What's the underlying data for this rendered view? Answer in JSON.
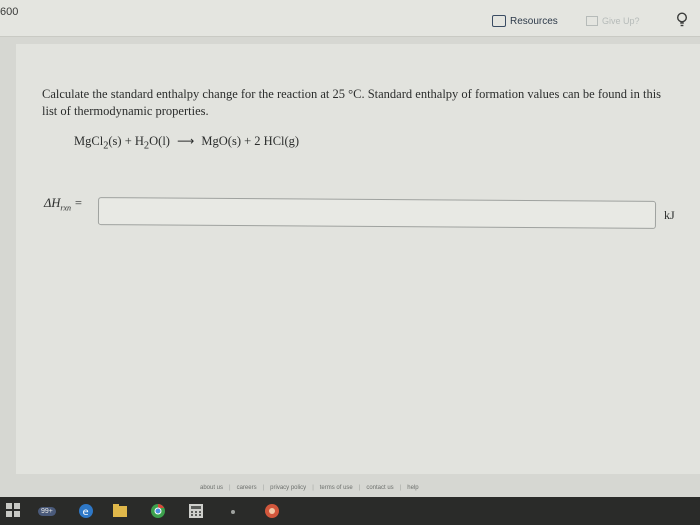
{
  "topbar": {
    "score": "600",
    "resources_label": "Resources",
    "give_up_label": "Give Up?"
  },
  "question": {
    "prompt": "Calculate the standard enthalpy change for the reaction at 25 °C. Standard enthalpy of formation values can be found in this",
    "link_text": "list of thermodynamic properties.",
    "reaction": {
      "r1": "MgCl",
      "r1_sub": "2",
      "r1_state": "(s) + H",
      "r2_sub": "2",
      "r2_rest": "O(l)",
      "arrow": "⟶",
      "products": "MgO(s) + 2 HCl(g)"
    },
    "dh_symbol": "ΔH",
    "dh_sub": "rxn",
    "dh_equals": " =",
    "answer_value": "",
    "unit": "kJ"
  },
  "footer": {
    "links": [
      "about us",
      "careers",
      "privacy policy",
      "terms of use",
      "contact us",
      "help"
    ]
  },
  "taskbar": {
    "badge": "99+"
  },
  "colors": {
    "accent_blue": "#3a4c63",
    "taskbar": "#2a2b29"
  }
}
